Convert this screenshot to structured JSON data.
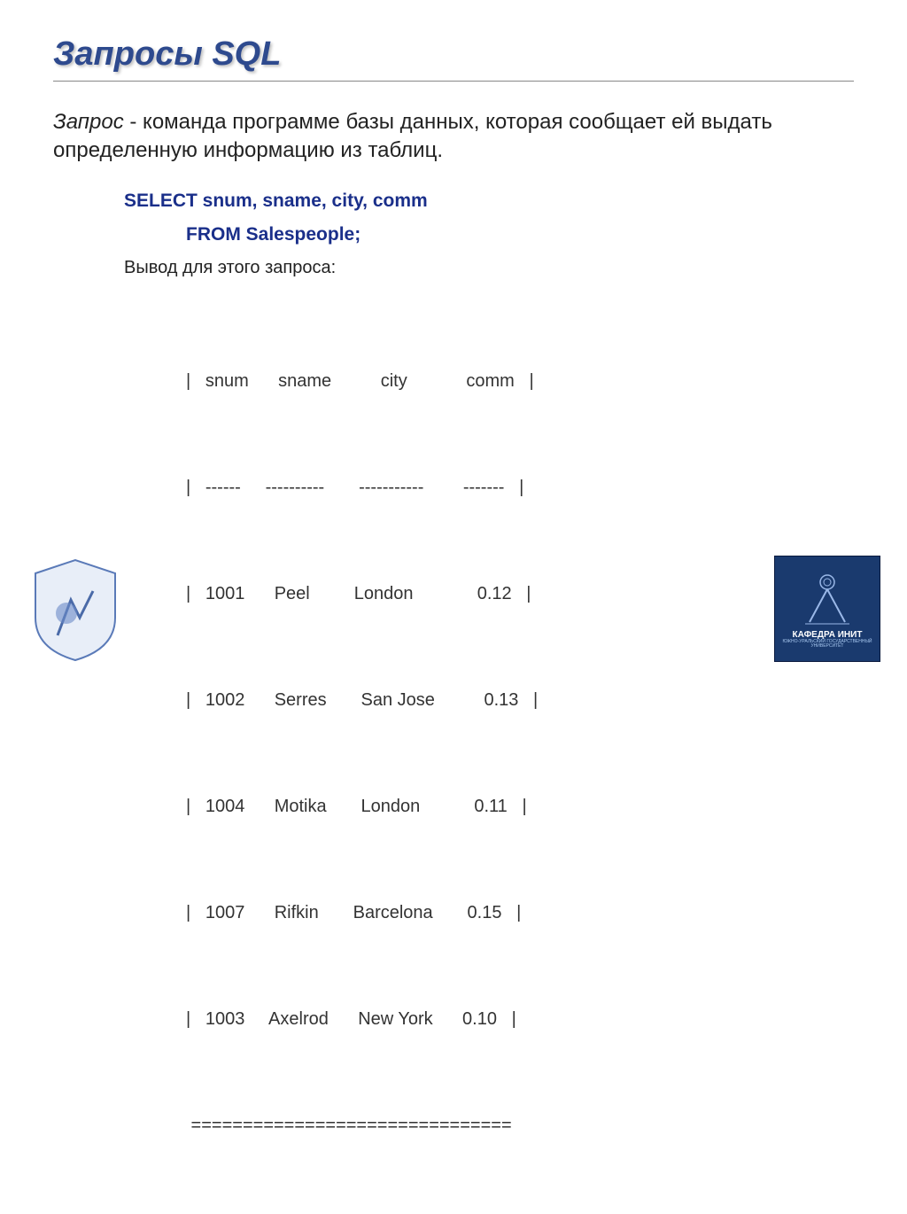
{
  "title": "Запросы SQL",
  "description_term": "Запрос",
  "description_rest": " - команда программе базы данных, которая сообщает ей выдать определенную информацию из таблиц.",
  "sql": {
    "line1": "SELECT snum, sname, city, comm",
    "line2": "FROM  Salespeople;"
  },
  "output_label": "Вывод для этого запроса:",
  "table": {
    "header": "|   snum      sname          city            comm   |",
    "sep": "|   ------     ----------       -----------        -------   |",
    "rows": [
      "|   1001      Peel         London             0.12   |",
      "|   1002      Serres       San Jose          0.13   |",
      "|   1004      Motika       London           0.11   |",
      "|   1007      Rifkin       Barcelona       0.15   |",
      "|   1003     Axelrod      New York      0.10   |"
    ],
    "footer": " ==============================="
  },
  "logo_right_label": "КАФЕДРА ИНИТ",
  "logo_right_sub": "ЮЖНО-УРАЛЬСКИЙ ГОСУДАРСТВЕННЫЙ УНИВЕРСИТЕТ"
}
